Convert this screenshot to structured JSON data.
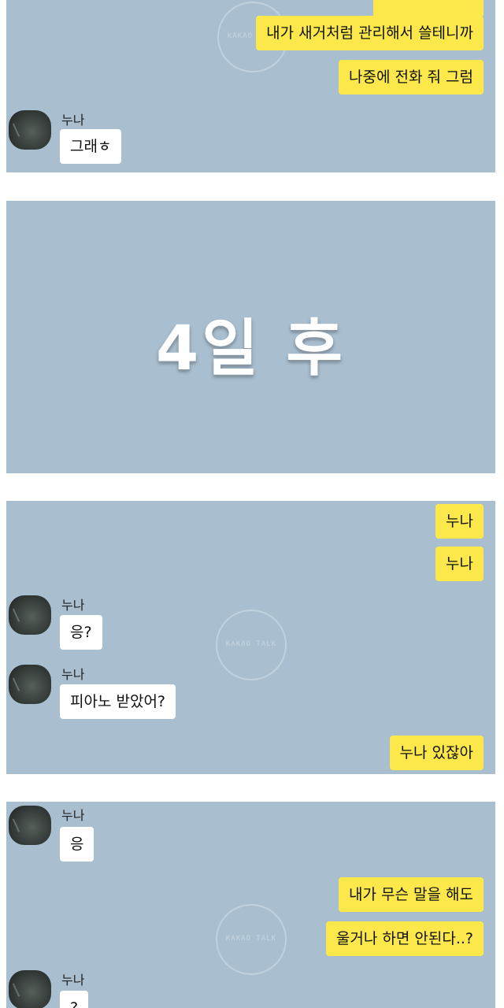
{
  "panel1": {
    "messages_mine": [
      "내가 새거처럼 관리해서 쓸테니까",
      "나중에 전화 줘 그럼"
    ],
    "sender": "누나",
    "messages_theirs": [
      "그래ㅎ"
    ]
  },
  "panel2": {
    "caption": "4일 후"
  },
  "panel3": {
    "messages_mine_top": [
      "누나",
      "누나"
    ],
    "sender": "누나",
    "messages_theirs": [
      "응?",
      "피아노 받았어?"
    ],
    "message_mine_bottom": "누나 있잖아"
  },
  "panel4": {
    "sender": "누나",
    "messages_theirs": [
      "응",
      "?"
    ],
    "messages_mine": [
      "내가 무슨 말을 해도",
      "울거나 하면 안된다..?"
    ]
  },
  "watermark": "KAKAO TALK"
}
